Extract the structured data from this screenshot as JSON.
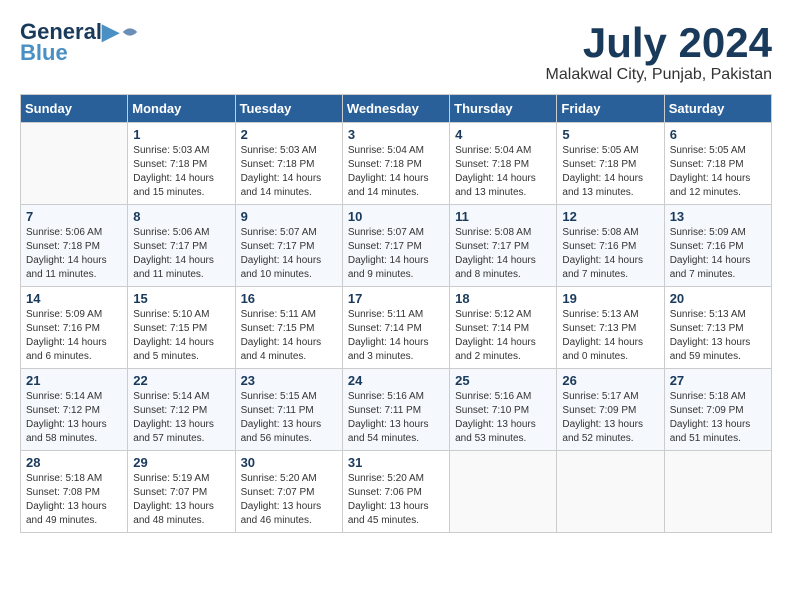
{
  "header": {
    "logo_line1": "General",
    "logo_line2": "Blue",
    "month": "July 2024",
    "location": "Malakwal City, Punjab, Pakistan"
  },
  "weekdays": [
    "Sunday",
    "Monday",
    "Tuesday",
    "Wednesday",
    "Thursday",
    "Friday",
    "Saturday"
  ],
  "weeks": [
    [
      {
        "day": "",
        "info": ""
      },
      {
        "day": "1",
        "info": "Sunrise: 5:03 AM\nSunset: 7:18 PM\nDaylight: 14 hours\nand 15 minutes."
      },
      {
        "day": "2",
        "info": "Sunrise: 5:03 AM\nSunset: 7:18 PM\nDaylight: 14 hours\nand 14 minutes."
      },
      {
        "day": "3",
        "info": "Sunrise: 5:04 AM\nSunset: 7:18 PM\nDaylight: 14 hours\nand 14 minutes."
      },
      {
        "day": "4",
        "info": "Sunrise: 5:04 AM\nSunset: 7:18 PM\nDaylight: 14 hours\nand 13 minutes."
      },
      {
        "day": "5",
        "info": "Sunrise: 5:05 AM\nSunset: 7:18 PM\nDaylight: 14 hours\nand 13 minutes."
      },
      {
        "day": "6",
        "info": "Sunrise: 5:05 AM\nSunset: 7:18 PM\nDaylight: 14 hours\nand 12 minutes."
      }
    ],
    [
      {
        "day": "7",
        "info": "Sunrise: 5:06 AM\nSunset: 7:18 PM\nDaylight: 14 hours\nand 11 minutes."
      },
      {
        "day": "8",
        "info": "Sunrise: 5:06 AM\nSunset: 7:17 PM\nDaylight: 14 hours\nand 11 minutes."
      },
      {
        "day": "9",
        "info": "Sunrise: 5:07 AM\nSunset: 7:17 PM\nDaylight: 14 hours\nand 10 minutes."
      },
      {
        "day": "10",
        "info": "Sunrise: 5:07 AM\nSunset: 7:17 PM\nDaylight: 14 hours\nand 9 minutes."
      },
      {
        "day": "11",
        "info": "Sunrise: 5:08 AM\nSunset: 7:17 PM\nDaylight: 14 hours\nand 8 minutes."
      },
      {
        "day": "12",
        "info": "Sunrise: 5:08 AM\nSunset: 7:16 PM\nDaylight: 14 hours\nand 7 minutes."
      },
      {
        "day": "13",
        "info": "Sunrise: 5:09 AM\nSunset: 7:16 PM\nDaylight: 14 hours\nand 7 minutes."
      }
    ],
    [
      {
        "day": "14",
        "info": "Sunrise: 5:09 AM\nSunset: 7:16 PM\nDaylight: 14 hours\nand 6 minutes."
      },
      {
        "day": "15",
        "info": "Sunrise: 5:10 AM\nSunset: 7:15 PM\nDaylight: 14 hours\nand 5 minutes."
      },
      {
        "day": "16",
        "info": "Sunrise: 5:11 AM\nSunset: 7:15 PM\nDaylight: 14 hours\nand 4 minutes."
      },
      {
        "day": "17",
        "info": "Sunrise: 5:11 AM\nSunset: 7:14 PM\nDaylight: 14 hours\nand 3 minutes."
      },
      {
        "day": "18",
        "info": "Sunrise: 5:12 AM\nSunset: 7:14 PM\nDaylight: 14 hours\nand 2 minutes."
      },
      {
        "day": "19",
        "info": "Sunrise: 5:13 AM\nSunset: 7:13 PM\nDaylight: 14 hours\nand 0 minutes."
      },
      {
        "day": "20",
        "info": "Sunrise: 5:13 AM\nSunset: 7:13 PM\nDaylight: 13 hours\nand 59 minutes."
      }
    ],
    [
      {
        "day": "21",
        "info": "Sunrise: 5:14 AM\nSunset: 7:12 PM\nDaylight: 13 hours\nand 58 minutes."
      },
      {
        "day": "22",
        "info": "Sunrise: 5:14 AM\nSunset: 7:12 PM\nDaylight: 13 hours\nand 57 minutes."
      },
      {
        "day": "23",
        "info": "Sunrise: 5:15 AM\nSunset: 7:11 PM\nDaylight: 13 hours\nand 56 minutes."
      },
      {
        "day": "24",
        "info": "Sunrise: 5:16 AM\nSunset: 7:11 PM\nDaylight: 13 hours\nand 54 minutes."
      },
      {
        "day": "25",
        "info": "Sunrise: 5:16 AM\nSunset: 7:10 PM\nDaylight: 13 hours\nand 53 minutes."
      },
      {
        "day": "26",
        "info": "Sunrise: 5:17 AM\nSunset: 7:09 PM\nDaylight: 13 hours\nand 52 minutes."
      },
      {
        "day": "27",
        "info": "Sunrise: 5:18 AM\nSunset: 7:09 PM\nDaylight: 13 hours\nand 51 minutes."
      }
    ],
    [
      {
        "day": "28",
        "info": "Sunrise: 5:18 AM\nSunset: 7:08 PM\nDaylight: 13 hours\nand 49 minutes."
      },
      {
        "day": "29",
        "info": "Sunrise: 5:19 AM\nSunset: 7:07 PM\nDaylight: 13 hours\nand 48 minutes."
      },
      {
        "day": "30",
        "info": "Sunrise: 5:20 AM\nSunset: 7:07 PM\nDaylight: 13 hours\nand 46 minutes."
      },
      {
        "day": "31",
        "info": "Sunrise: 5:20 AM\nSunset: 7:06 PM\nDaylight: 13 hours\nand 45 minutes."
      },
      {
        "day": "",
        "info": ""
      },
      {
        "day": "",
        "info": ""
      },
      {
        "day": "",
        "info": ""
      }
    ]
  ]
}
